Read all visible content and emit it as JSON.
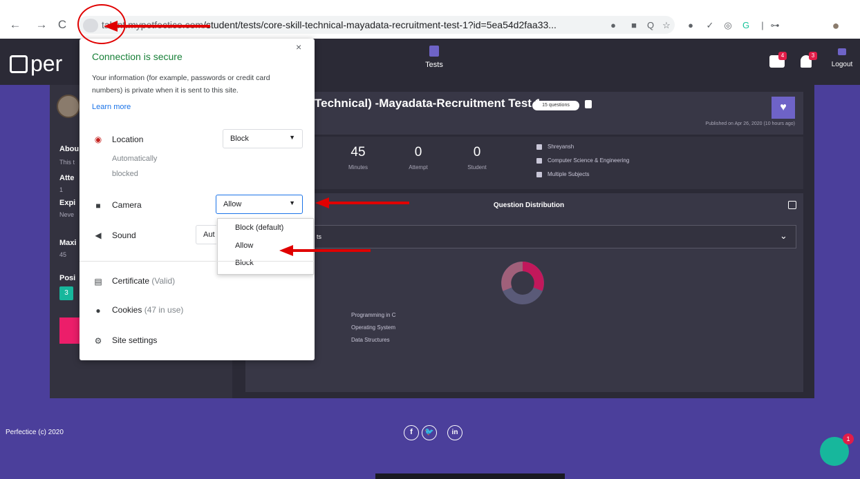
{
  "browser": {
    "nav": {
      "back": "←",
      "forward": "→",
      "reload": "C"
    },
    "url_host": "talent.mypetfectice.com",
    "url_path": "/student/tests/core-skill-technical-mayadata-recruitment-test-1?id=5ea54d2faa33...",
    "extensions": [
      "●",
      "■",
      "Q",
      "☆",
      "●",
      "✓",
      "◎",
      "G",
      "|",
      "⊶",
      "●"
    ]
  },
  "app": {
    "logo": "per",
    "nav_tests": "Tests",
    "mail_badge": "4",
    "bell_badge": "3",
    "logout": "Logout"
  },
  "left": {
    "about_label": "Abou",
    "about_sub": "This t",
    "attempt_label": "Atte",
    "attempt_val": "1",
    "expiry_label": "Expi",
    "expiry_val": "Neve",
    "max_label": "Maxi",
    "max_val": "45",
    "pos_label": "Posi",
    "pos_val": "3"
  },
  "test": {
    "title": "Technical) -Mayadata-Recruitment Test 1",
    "questions": "15 questions",
    "published": "Published on Apr 26, 2020 (10 hours ago)",
    "stats": [
      {
        "num": "45",
        "cap": "Minutes"
      },
      {
        "num": "0",
        "cap": "Attempt"
      },
      {
        "num": "0",
        "cap": "Student"
      }
    ],
    "meta": [
      "Shreyansh",
      "Computer Science & Engineering",
      "Multiple Subjects"
    ]
  },
  "distribution": {
    "title": "Question Distribution",
    "select_text": "ts",
    "legend": [
      "Programming in C",
      "Operating System",
      "Data Structures"
    ],
    "colors": [
      "#c2185b",
      "#a0607a",
      "#5a5a78"
    ]
  },
  "footer": {
    "text": "Perfectice (c) 2020",
    "social": [
      "f",
      "🐦",
      "in"
    ],
    "chat_badge": "1"
  },
  "popup": {
    "title": "Connection is secure",
    "close": "×",
    "desc": "Your information (for example, passwords or credit card numbers) is private when it is sent to this site.",
    "learn_more": "Learn more",
    "location_label": "Location",
    "location_sub1": "Automatically",
    "location_sub2": "blocked",
    "location_value": "Block",
    "camera_label": "Camera",
    "camera_value": "Allow",
    "sound_label": "Sound",
    "sound_value": "Aut",
    "dropdown_options": [
      "Block (default)",
      "Allow",
      "Block"
    ],
    "certificate": "Certificate",
    "certificate_sub": "(Valid)",
    "cookies": "Cookies",
    "cookies_sub": "(47 in use)",
    "site_settings": "Site settings"
  }
}
